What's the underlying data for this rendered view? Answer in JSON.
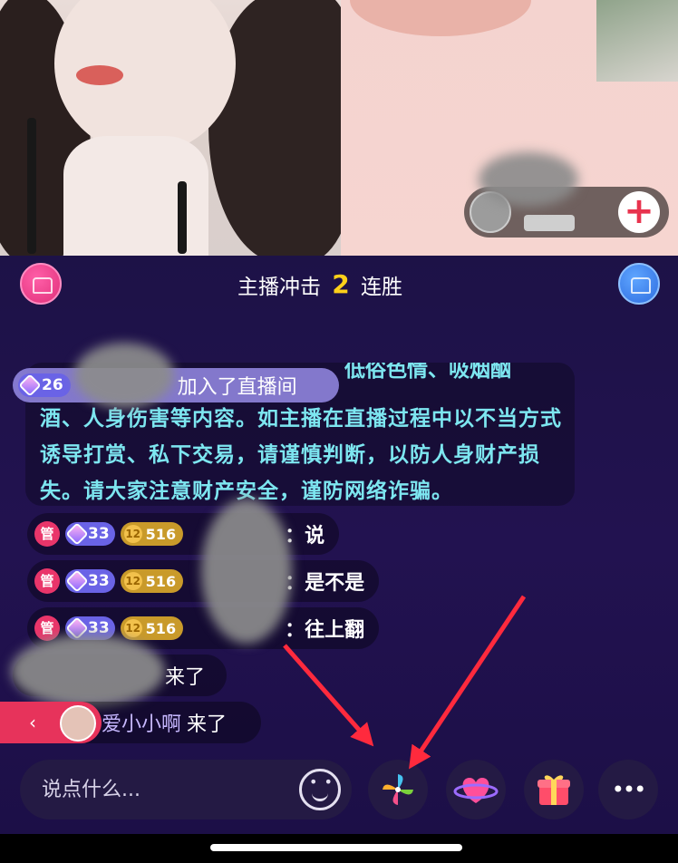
{
  "battle": {
    "prefix": "主播冲击",
    "streak_num": "2",
    "suffix": "连胜"
  },
  "join_banner": {
    "level": "26",
    "text": "加入了直播间"
  },
  "notice": {
    "partial_top": "低俗色情、吸烟酗",
    "text": "酒、人身伤害等内容。如主播在直播过程中以不当方式诱导打赏、私下交易，请谨慎判断，以防人身财产损失。请大家注意财产安全，谨防网络诈骗。"
  },
  "chat": [
    {
      "admin_tag": "管",
      "level": "33",
      "fan_level": "12",
      "fan_value": "516",
      "message": "：说"
    },
    {
      "admin_tag": "管",
      "level": "33",
      "fan_level": "12",
      "fan_value": "516",
      "message": "：是不是"
    },
    {
      "admin_tag": "管",
      "level": "33",
      "fan_level": "12",
      "fan_value": "516",
      "message": "：往上翻"
    }
  ],
  "enter_rows": [
    {
      "name": "",
      "text": "来了"
    },
    {
      "name": "爱小小啊",
      "text": "来了"
    }
  ],
  "side_tab": {
    "label": "‹"
  },
  "input": {
    "placeholder": "说点什么..."
  },
  "toolbar": {
    "icons": [
      "emoji-icon",
      "pinwheel-icon",
      "heart-planet-icon",
      "gift-icon",
      "more-icon"
    ],
    "more_label": "•••"
  },
  "colors": {
    "accent_pink": "#e7335b",
    "notice_cyan": "#7de6f0",
    "streak_yellow": "#ffd11a",
    "level_purple": "#6a63e6",
    "fan_gold": "#c99a2a",
    "arrow_red": "#ff2a3d"
  }
}
